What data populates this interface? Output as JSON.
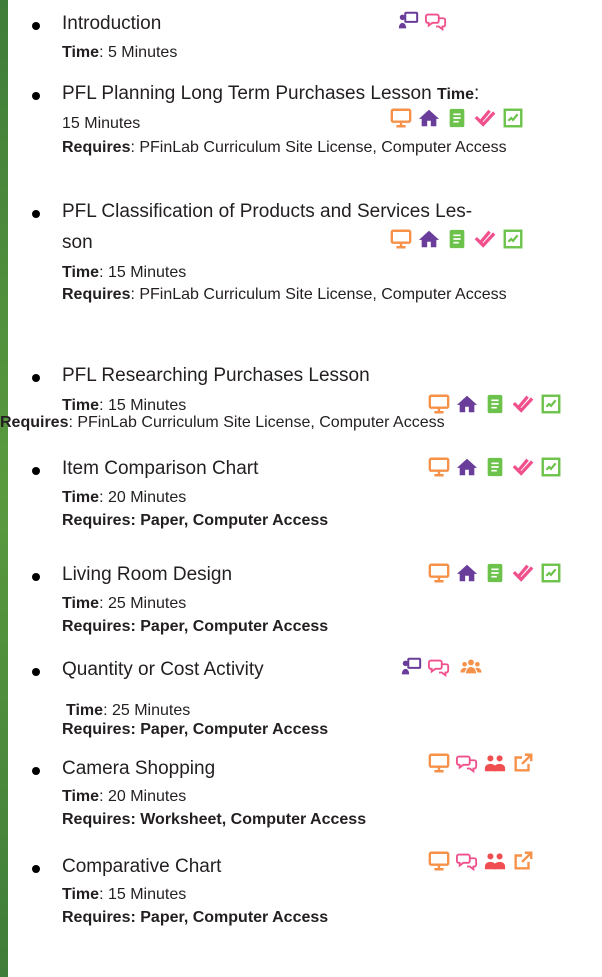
{
  "items": [
    {
      "title": "Introduction",
      "time_label": "Time",
      "time": ": 5 Minutes",
      "icons": [
        "projector-screen-icon",
        "chat-bubbles-icon"
      ]
    },
    {
      "title": "PFL Planning Long Term Purchases Lesson",
      "time_label": "Time",
      "time_colon": ":",
      "time": "15 Minutes",
      "req_label": "Requires",
      "requires": ": PFinLab Curriculum Site License, Computer Access",
      "icons": [
        "monitor-icon",
        "house-icon",
        "notes-icon",
        "checkmarks-icon",
        "checklist-icon"
      ]
    },
    {
      "title": "PFL Classification of Products and Services Les-",
      "title2": "son",
      "time_label": "Time",
      "time": ": 15 Minutes",
      "req_label": "Requires",
      "requires": ": PFinLab Curriculum Site License, Computer Access",
      "icons": [
        "monitor-icon",
        "house-icon",
        "notes-icon",
        "checkmarks-icon",
        "checklist-icon"
      ]
    },
    {
      "title": "PFL  Researching Purchases Lesson",
      "time_label": "Time",
      "time": ": 15 Minutes",
      "req_label": "Requires",
      "requires": ": PFinLab Curriculum Site License, Computer Access",
      "icons": [
        "monitor-icon",
        "house-icon",
        "notes-icon",
        "checkmarks-icon",
        "checklist-icon"
      ]
    },
    {
      "title": "Item Comparison Chart",
      "time_label": "Time",
      "time": ": 20 Minutes",
      "requires_bold": "Requires: Paper, Computer Access",
      "icons": [
        "monitor-icon",
        "house-icon",
        "notes-icon",
        "checkmarks-icon",
        "checklist-icon"
      ]
    },
    {
      "title": "Living Room Design",
      "time_label": "Time",
      "time": ": 25 Minutes",
      "requires_bold": "Requires: Paper, Computer Access",
      "icons": [
        "monitor-icon",
        "house-icon",
        "notes-icon",
        "checkmarks-icon",
        "checklist-icon"
      ]
    },
    {
      "title": "Quantity or Cost Activity",
      "time_label": "Time",
      "time": ": 25 Minutes",
      "requires_bold": "Requires: Paper, Computer Access",
      "icons": [
        "projector-screen-icon",
        "chat-bubbles-icon",
        "group-icon"
      ]
    },
    {
      "title": "Camera Shopping",
      "time_label": "Time",
      "time": ": 20 Minutes",
      "requires_bold": "Requires: Worksheet, Computer Access",
      "icons": [
        "monitor-icon",
        "chat-bubbles-icon",
        "pair-icon",
        "external-link-icon"
      ]
    },
    {
      "title": "Comparative Chart",
      "time_label": "Time",
      "time": ": 15 Minutes",
      "requires_bold": "Requires: Paper,  Computer Access",
      "icons": [
        "monitor-icon",
        "chat-bubbles-icon",
        "pair-icon",
        "external-link-icon"
      ]
    }
  ],
  "colors": {
    "purple": "#6a3d9a",
    "orange": "#f6914a",
    "green": "#6cc24a",
    "pink": "#f0508c",
    "red": "#f04e51",
    "bar": "#4f8f3c"
  }
}
